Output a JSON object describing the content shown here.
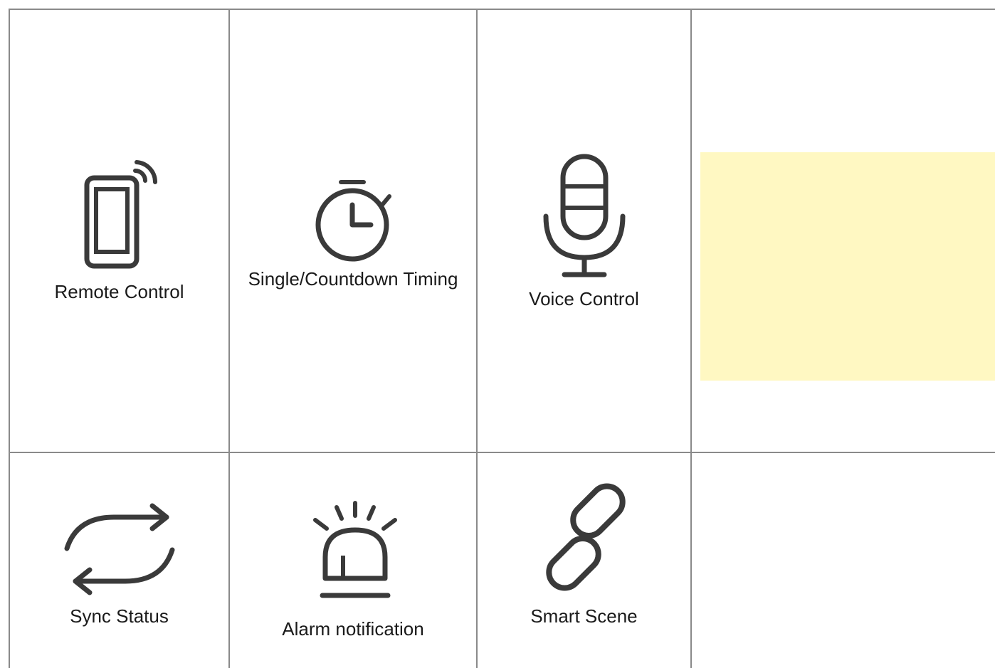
{
  "features": {
    "row1": [
      {
        "label": "Remote Control",
        "icon": "smartphone-signal-icon"
      },
      {
        "label": "Single/Countdown Timing",
        "icon": "stopwatch-icon"
      },
      {
        "label": "Voice Control",
        "icon": "microphone-icon"
      }
    ],
    "row2": [
      {
        "label": "Sync Status",
        "icon": "sync-arrows-icon"
      },
      {
        "label": "Alarm notification",
        "icon": "alarm-siren-icon"
      },
      {
        "label": "Smart Scene",
        "icon": "chain-link-icon"
      }
    ]
  },
  "colors": {
    "icon_stroke": "#3a3a3a",
    "grid_line": "#8a8a8a",
    "highlight": "#fff8c2"
  }
}
